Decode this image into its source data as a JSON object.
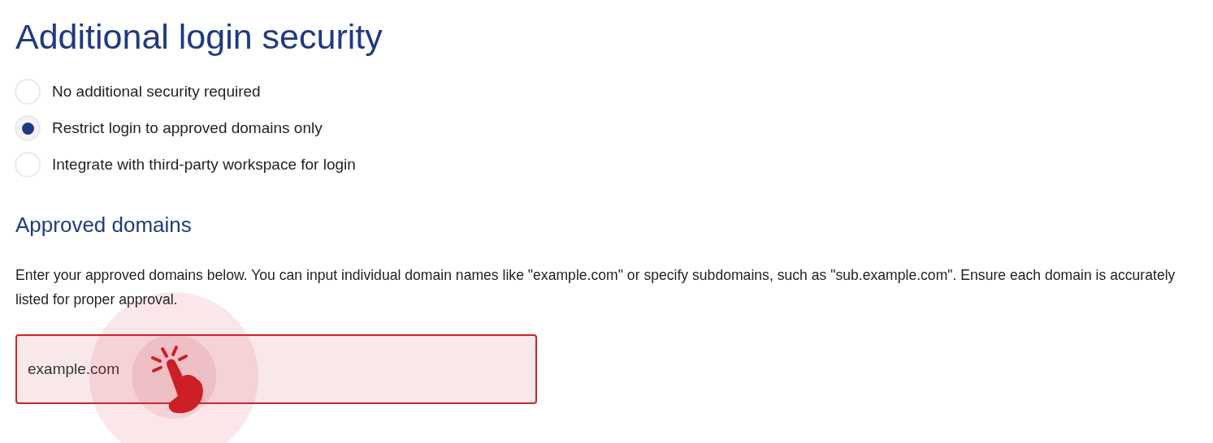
{
  "title": "Additional login security",
  "options": [
    {
      "label": "No additional security required",
      "selected": false
    },
    {
      "label": "Restrict login to approved domains only",
      "selected": true
    },
    {
      "label": "Integrate with third-party workspace for login",
      "selected": false
    }
  ],
  "section": {
    "heading": "Approved domains",
    "description": "Enter your approved domains below. You can input individual domain names like \"example.com\" or specify subdomains, such as \"sub.example.com\". Ensure each domain is accurately listed for proper approval.",
    "field": {
      "value": "example.com",
      "error": true
    }
  }
}
